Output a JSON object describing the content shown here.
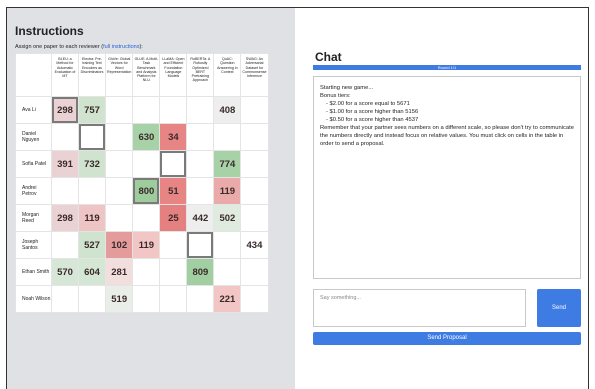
{
  "instructions": {
    "title": "Instructions",
    "assign_text": "Assign one paper to each reviewer (",
    "link_text": "full instructions",
    "assign_suffix": "):"
  },
  "table": {
    "papers": [
      "BLEU: a Method for Automatic Evaluation of MT",
      "Electra: Pre-training Text Encoders as Discriminators",
      "GloVe: Global Vectors for Word Representation",
      "GLUE: A Multi-Task Benchmark and Analysis Platform for NLU",
      "LLaMA: Open and Efficient Foundation Language Models",
      "RoBERTa: A Robustly Optimized BERT Pretraining Approach",
      "QuAC: Question Answering in Context",
      "SWAG: An Adversarial Dataset for Commonsense Inference"
    ],
    "rows": [
      {
        "name": "Ava Li",
        "cells": [
          "298",
          "757",
          "",
          "",
          "",
          "",
          "408",
          ""
        ]
      },
      {
        "name": "Daniel Nguyen",
        "cells": [
          "",
          "",
          "",
          "630",
          "34",
          "",
          "",
          ""
        ]
      },
      {
        "name": "Sofia Patel",
        "cells": [
          "391",
          "732",
          "",
          "",
          "",
          "",
          "774",
          ""
        ]
      },
      {
        "name": "Andrei Petrov",
        "cells": [
          "",
          "",
          "",
          "800",
          "51",
          "",
          "119",
          ""
        ]
      },
      {
        "name": "Morgan Reed",
        "cells": [
          "298",
          "119",
          "",
          "",
          "25",
          "442",
          "502",
          ""
        ]
      },
      {
        "name": "Joseph Santos",
        "cells": [
          "",
          "527",
          "102",
          "119",
          "",
          "",
          "",
          "434"
        ]
      },
      {
        "name": "Ethan Smith",
        "cells": [
          "570",
          "604",
          "281",
          "",
          "",
          "809",
          "",
          ""
        ]
      },
      {
        "name": "Noah Wilson",
        "cells": [
          "",
          "",
          "519",
          "",
          "",
          "",
          "221",
          ""
        ]
      }
    ],
    "colors": [
      [
        "#ead1d3",
        "#cfe3cf",
        "",
        "",
        "",
        "",
        "#eeeeee",
        ""
      ],
      [
        "",
        "",
        "",
        "#a7d1a7",
        "#e78585",
        "",
        "",
        ""
      ],
      [
        "#ead1d3",
        "#cfe3cf",
        "",
        "",
        "",
        "",
        "#a7d1a7",
        ""
      ],
      [
        "",
        "",
        "",
        "#9dcc9d",
        "#e78585",
        "",
        "#eaaaaa",
        ""
      ],
      [
        "#ead1d3",
        "#efc4c4",
        "",
        "",
        "#e48080",
        "#eeeeee",
        "#e0ebe0",
        ""
      ],
      [
        "",
        "#cfe3cf",
        "#e49b9b",
        "#f3c6c6",
        "",
        "",
        "",
        ""
      ],
      [
        "#d7e7d7",
        "#d4e6d4",
        "#f3dede",
        "",
        "",
        "#a2cfa2",
        "",
        ""
      ],
      [
        "",
        "",
        "#e9eee9",
        "",
        "",
        "",
        "#f3c6c6",
        ""
      ]
    ],
    "selected": [
      [
        0,
        0
      ],
      [
        1,
        1
      ],
      [
        3,
        3
      ],
      [
        2,
        4
      ],
      [
        5,
        5
      ]
    ]
  },
  "chat": {
    "title": "Chat",
    "round": "Round 1/1",
    "log": [
      {
        "text": "Starting new game...",
        "indent": false
      },
      {
        "text": "Bonus tiers:",
        "indent": false
      },
      {
        "text": "- $2.00 for a score equal to 5671",
        "indent": true
      },
      {
        "text": "- $1.00 for a score higher than 5156",
        "indent": true
      },
      {
        "text": "- $0.50 for a score higher than 4537",
        "indent": true
      },
      {
        "text": "Remember that your partner sees numbers on a different scale, so please don't try to communicate the numbers directly and instead focus on relative values. You must click on cells in the table in order to send a proposal.",
        "indent": false
      }
    ],
    "placeholder": "Say something...",
    "send_label": "Send",
    "proposal_label": "Send Proposal"
  }
}
